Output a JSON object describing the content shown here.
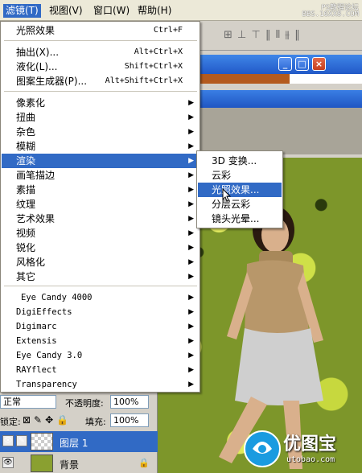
{
  "menubar": {
    "items": [
      "滤镜(T)",
      "视图(V)",
      "窗口(W)",
      "帮助(H)"
    ],
    "watermark_1": "PS教程论坛",
    "watermark_2": "BBS.16XX8.COM"
  },
  "filter_menu": {
    "last_filter": {
      "label": "光照效果",
      "shortcut": "Ctrl+F"
    },
    "group2": [
      {
        "label": "抽出(X)...",
        "shortcut": "Alt+Ctrl+X"
      },
      {
        "label": "液化(L)...",
        "shortcut": "Shift+Ctrl+X"
      },
      {
        "label": "图案生成器(P)...",
        "shortcut": "Alt+Shift+Ctrl+X"
      }
    ],
    "group3": [
      "像素化",
      "扭曲",
      "杂色",
      "模糊",
      "渲染",
      "画笔描边",
      "素描",
      "纹理",
      "艺术效果",
      "视频",
      "锐化",
      "风格化",
      "其它"
    ],
    "highlighted": "渲染",
    "group4": [
      "Eye Candy 4000",
      "DigiEffects",
      "Digimarc",
      "Extensis",
      "Eye Candy 3.0",
      "RAYflect",
      "Transparency"
    ]
  },
  "render_submenu": {
    "items": [
      "3D 变换...",
      "云彩",
      "光照效果...",
      "分层云彩",
      "镜头光晕..."
    ],
    "highlighted": "光照效果..."
  },
  "layers_panel": {
    "blend_mode": "正常",
    "opacity_label": "不透明度:",
    "opacity_value": "100%",
    "lock_label": "锁定:",
    "fill_label": "填充:",
    "fill_value": "100%",
    "layers": [
      {
        "name": "图层 1",
        "selected": true
      },
      {
        "name": "背景",
        "selected": false
      }
    ]
  },
  "logo": {
    "text": "优图宝",
    "url": "utobao.com"
  },
  "colors": {
    "menu_highlight": "#316ac5",
    "title_bar": "#2c6bd6"
  }
}
